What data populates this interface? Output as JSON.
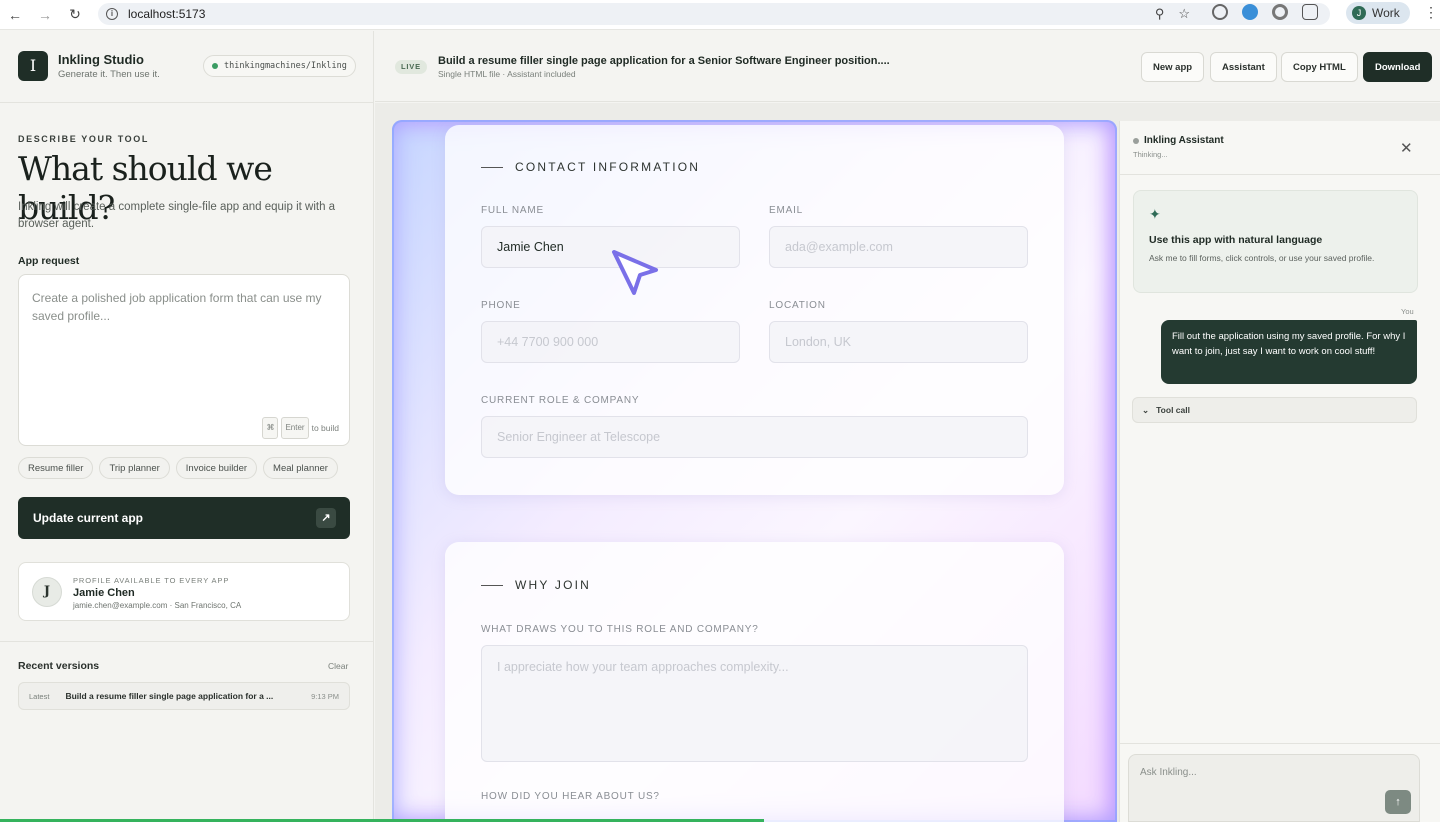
{
  "browser": {
    "url": "localhost:5173",
    "back_icon": "arrow-left-icon",
    "forward_icon": "arrow-right-icon",
    "reload_icon": "reload-icon",
    "profile_initial": "J",
    "profile_label": "Work"
  },
  "brand": {
    "logo_letter": "I",
    "name": "Inkling Studio",
    "tagline": "Generate it. Then use it.",
    "repo": "thinkingmachines/Inkling"
  },
  "composer": {
    "kicker": "DESCRIBE YOUR TOOL",
    "headline": "What should we build?",
    "description": "Inkling will create a complete single-file app and equip it with a browser agent.",
    "field_label": "App request",
    "placeholder": "Create a polished job application form that can use my saved profile...",
    "hint_key1": "⌘",
    "hint_key2": "Enter",
    "hint_text": "to build",
    "templates": [
      "Resume filler",
      "Trip planner",
      "Invoice builder",
      "Meal planner"
    ],
    "submit_label": "Update current app"
  },
  "profile": {
    "kicker": "PROFILE AVAILABLE TO EVERY APP",
    "initial": "J",
    "name": "Jamie Chen",
    "detail": "jamie.chen@example.com · San Francisco, CA"
  },
  "recent": {
    "title": "Recent versions",
    "clear_label": "Clear",
    "items": [
      {
        "tag": "Latest",
        "text": "Build a resume filler single page application for a ...",
        "time": "9:13 PM"
      }
    ]
  },
  "header": {
    "live_label": "LIVE",
    "title": "Build a resume filler single page application for a Senior Software Engineer position....",
    "subtitle": "Single HTML file · Assistant included",
    "buttons": {
      "new_app": "New app",
      "assistant": "Assistant",
      "copy_html": "Copy HTML",
      "download": "Download"
    }
  },
  "form": {
    "contact": {
      "heading": "CONTACT INFORMATION",
      "full_name_label": "FULL NAME",
      "full_name_value": "Jamie Chen",
      "email_label": "EMAIL",
      "email_placeholder": "ada@example.com",
      "phone_label": "PHONE",
      "phone_placeholder": "+44 7700 900 000",
      "location_label": "LOCATION",
      "location_placeholder": "London, UK",
      "role_label": "CURRENT ROLE & COMPANY",
      "role_placeholder": "Senior Engineer at Telescope"
    },
    "why": {
      "heading": "WHY JOIN",
      "draws_label": "WHAT DRAWS YOU TO THIS ROLE AND COMPANY?",
      "draws_placeholder": "I appreciate how your team approaches complexity...",
      "heard_label": "HOW DID YOU HEAR ABOUT US?"
    }
  },
  "assistant": {
    "title": "Inkling Assistant",
    "status": "Thinking...",
    "intro_title": "Use this app with natural language",
    "intro_desc": "Ask me to fill forms, click controls, or use your saved profile.",
    "you_label": "You",
    "user_message": "Fill out the application using my saved profile. For why I want to join, just say I want to work on cool stuff!",
    "tool_call_label": "Tool call",
    "input_placeholder": "Ask Inkling..."
  },
  "colors": {
    "brand_dark": "#1f2e27",
    "accent_green": "#3b9c63",
    "progress": "#35b35d"
  }
}
